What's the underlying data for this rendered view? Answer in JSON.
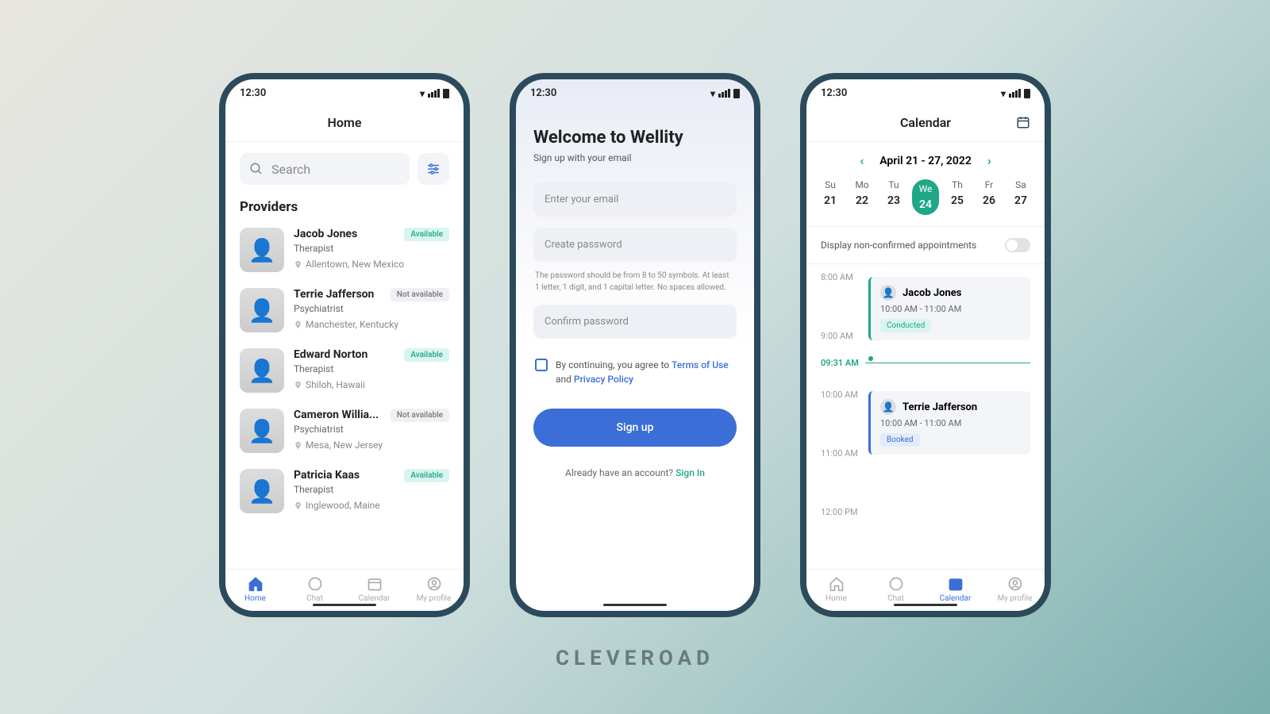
{
  "statusbar": {
    "time": "12:30"
  },
  "brand": "CLEVEROAD",
  "phone1": {
    "title": "Home",
    "search_placeholder": "Search",
    "section": "Providers",
    "providers": [
      {
        "name": "Jacob Jones",
        "role": "Therapist",
        "location": "Allentown, New Mexico",
        "status": "Available",
        "avail": true
      },
      {
        "name": "Terrie Jafferson",
        "role": "Psychiatrist",
        "location": "Manchester, Kentucky",
        "status": "Not available",
        "avail": false
      },
      {
        "name": "Edward Norton",
        "role": "Therapist",
        "location": "Shiloh, Hawaii",
        "status": "Available",
        "avail": true
      },
      {
        "name": "Cameron Willia...",
        "role": "Psychiatrist",
        "location": "Mesa, New Jersey",
        "status": "Not available",
        "avail": false
      },
      {
        "name": "Patricia Kaas",
        "role": "Therapist",
        "location": "Inglewood, Maine",
        "status": "Available",
        "avail": true
      }
    ],
    "tabs": [
      {
        "label": "Home"
      },
      {
        "label": "Chat"
      },
      {
        "label": "Calendar"
      },
      {
        "label": "My profile"
      }
    ]
  },
  "phone2": {
    "title": "Welcome to Wellity",
    "subtitle": "Sign up with your email",
    "email_placeholder": "Enter your email",
    "pw_placeholder": "Create password",
    "pw_hint": "The password should be from 8 to 50 symbols. At least 1 letter, 1 digit, and 1 capital letter. No spaces allowed.",
    "confirm_placeholder": "Confirm password",
    "agree_prefix": "By continuing, you agree to ",
    "terms": "Terms of Use",
    "and": " and ",
    "privacy": "Privacy Policy",
    "signup": "Sign up",
    "already": "Already  have an account? ",
    "signin": "Sign In"
  },
  "phone3": {
    "title": "Calendar",
    "range": "April 21 - 27, 2022",
    "days": [
      {
        "dow": "Su",
        "num": "21"
      },
      {
        "dow": "Mo",
        "num": "22"
      },
      {
        "dow": "Tu",
        "num": "23"
      },
      {
        "dow": "We",
        "num": "24",
        "sel": true
      },
      {
        "dow": "Th",
        "num": "25"
      },
      {
        "dow": "Fr",
        "num": "26"
      },
      {
        "dow": "Sa",
        "num": "27"
      }
    ],
    "toggle_label": "Display non-confirmed appointments",
    "times": [
      "8:00 AM",
      "9:00 AM",
      "10:00 AM",
      "11:00 AM",
      "12:00 PM"
    ],
    "now": "09:31 AM",
    "appts": [
      {
        "name": "Jacob Jones",
        "time": "10:00 AM - 11:00 AM",
        "badge": "Conducted",
        "kind": "cond"
      },
      {
        "name": "Terrie Jafferson",
        "time": "10:00 AM - 11:00 AM",
        "badge": "Booked",
        "kind": "book"
      }
    ],
    "tabs": [
      {
        "label": "Home"
      },
      {
        "label": "Chat"
      },
      {
        "label": "Calendar"
      },
      {
        "label": "My profile"
      }
    ]
  }
}
